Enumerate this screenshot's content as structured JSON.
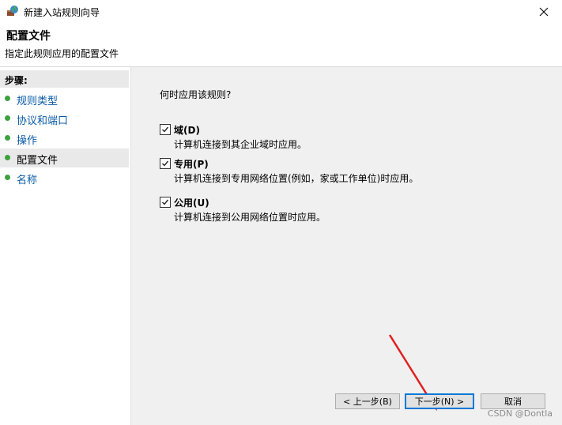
{
  "window": {
    "title": "新建入站规则向导"
  },
  "header": {
    "title": "配置文件",
    "subtitle": "指定此规则应用的配置文件"
  },
  "sidebar": {
    "heading": "步骤:",
    "items": [
      {
        "label": "规则类型"
      },
      {
        "label": "协议和端口"
      },
      {
        "label": "操作"
      },
      {
        "label": "配置文件",
        "active": true
      },
      {
        "label": "名称"
      }
    ]
  },
  "main": {
    "question": "何时应用该规则?",
    "options": [
      {
        "label": "域(D)",
        "description": "计算机连接到其企业域时应用。",
        "checked": true
      },
      {
        "label": "专用(P)",
        "description": "计算机连接到专用网络位置(例如，家或工作单位)时应用。",
        "checked": true
      },
      {
        "label": "公用(U)",
        "description": "计算机连接到公用网络位置时应用。",
        "checked": true
      }
    ]
  },
  "footer": {
    "back_label": "< 上一步(B)",
    "next_label": "下一步(N) >",
    "cancel_label": "取消"
  },
  "watermark": "CSDN @Dontla",
  "colors": {
    "accent": "#0078d7",
    "step_dot": "#3da23d",
    "link": "#0a5ca8",
    "arrow": "#e02020"
  }
}
